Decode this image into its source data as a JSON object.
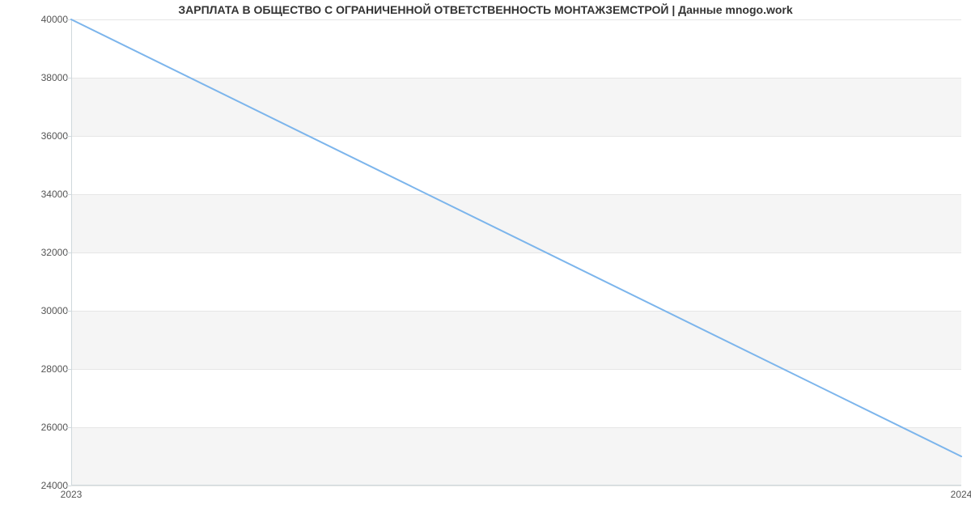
{
  "chart_data": {
    "type": "line",
    "title": "ЗАРПЛАТА В ОБЩЕСТВО С ОГРАНИЧЕННОЙ ОТВЕТСТВЕННОСТЬ МОНТАЖЗЕМСТРОЙ | Данные mnogo.work",
    "xlabel": "",
    "ylabel": "",
    "x": [
      2023,
      2024
    ],
    "values": [
      40000,
      25000
    ],
    "xticks": [
      "2023",
      "2024"
    ],
    "yticks": [
      24000,
      26000,
      28000,
      30000,
      32000,
      34000,
      36000,
      38000,
      40000
    ],
    "ylim": [
      24000,
      40000
    ],
    "xlim": [
      2023,
      2024
    ],
    "line_color": "#7cb5ec",
    "grid": true
  }
}
